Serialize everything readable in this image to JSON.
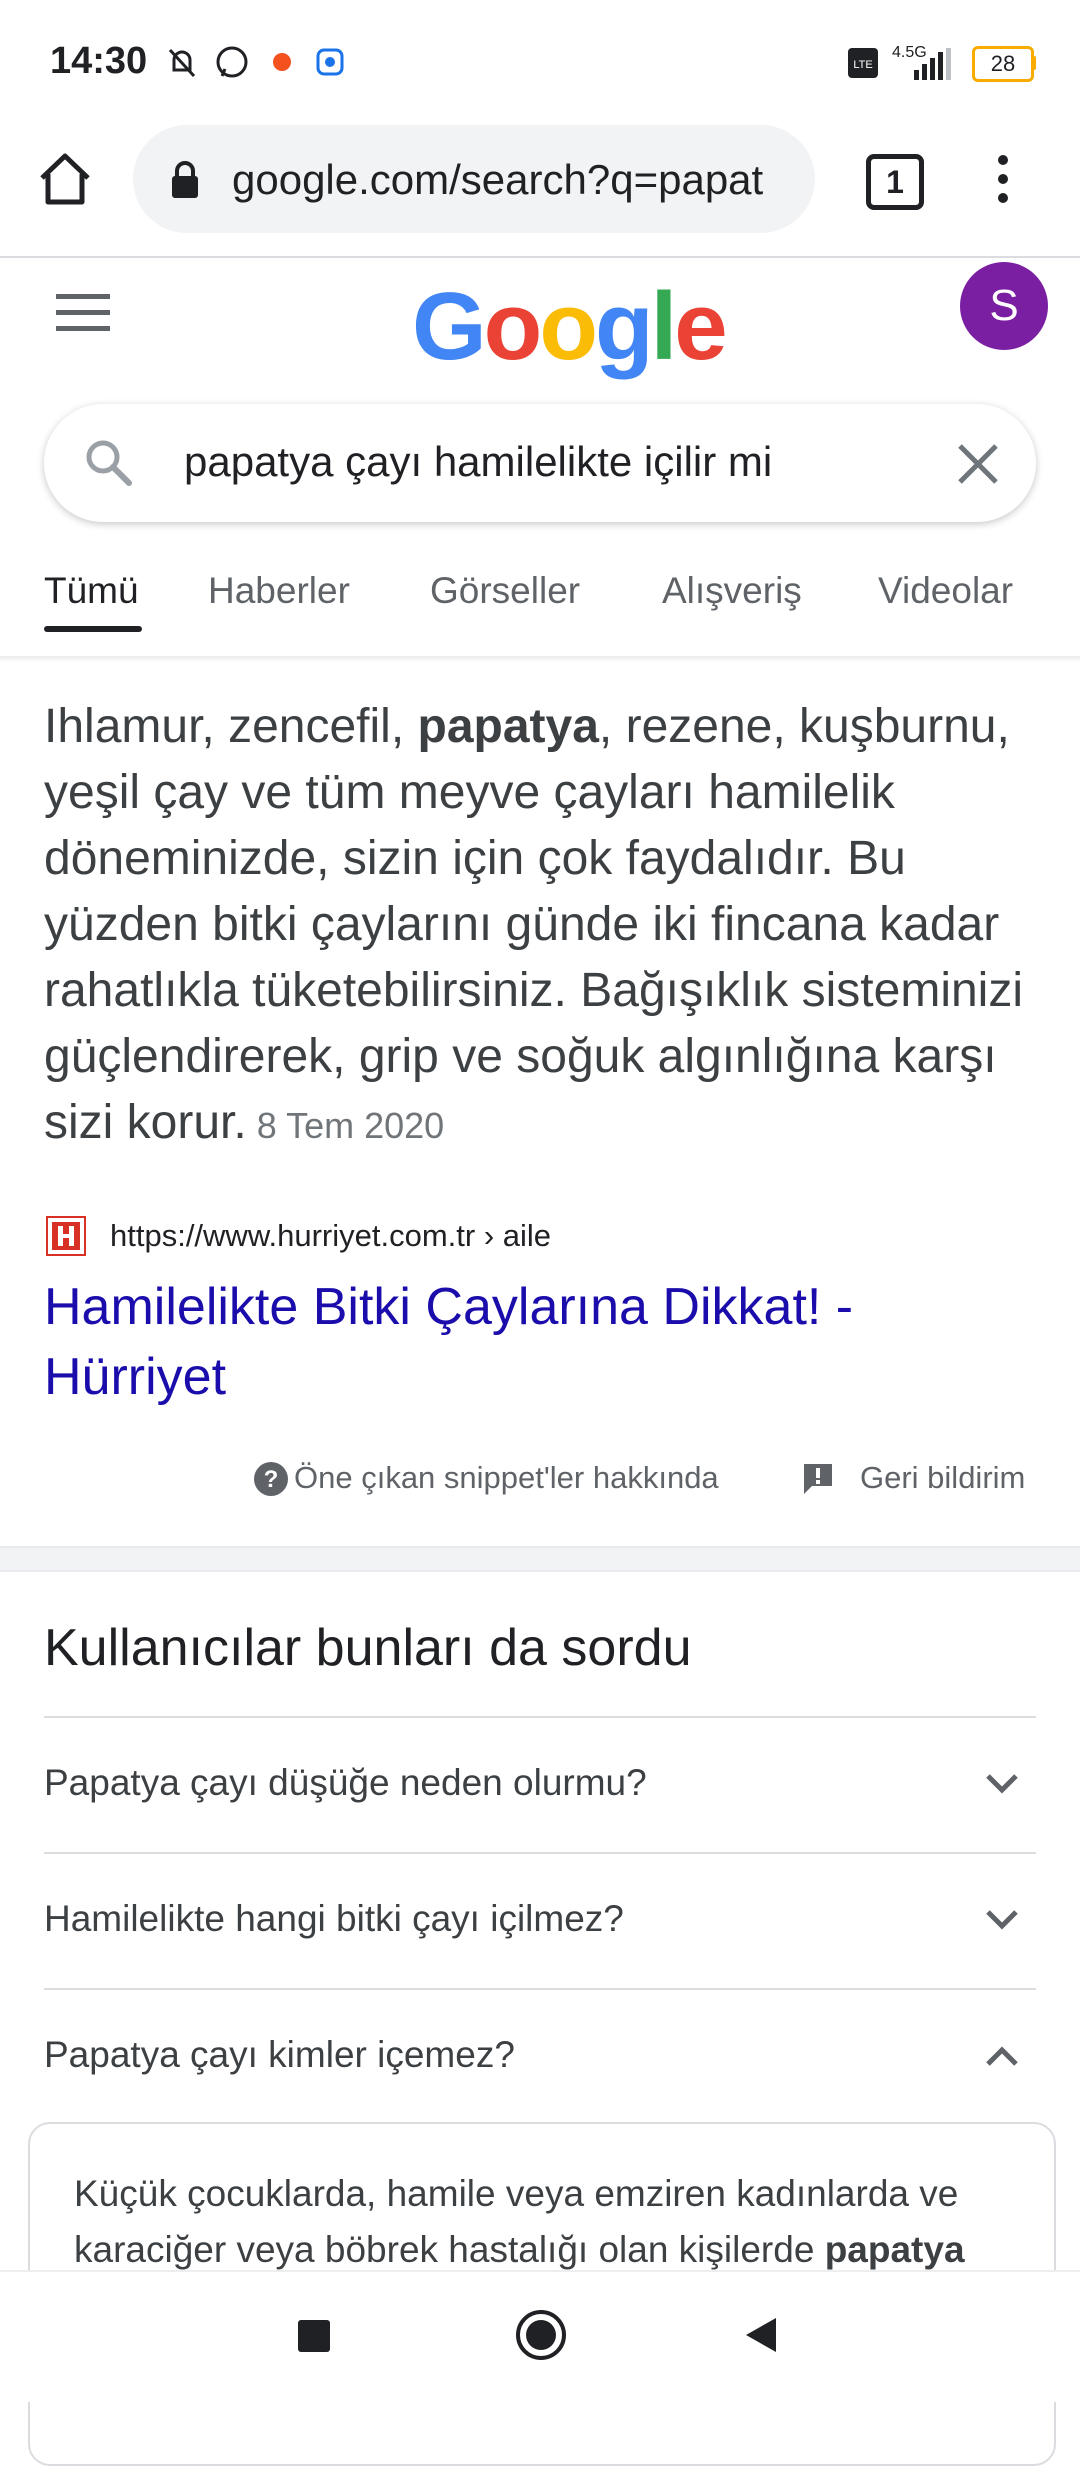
{
  "status_bar": {
    "time": "14:30",
    "network": "4.5G",
    "battery": "28",
    "icons": [
      "mute-icon",
      "whatsapp-icon",
      "notification-icon",
      "lens-icon",
      "volte-icon",
      "signal-icon",
      "battery-icon"
    ]
  },
  "browser": {
    "url": "google.com/search?q=papat",
    "tab_count": "1"
  },
  "google": {
    "avatar_letter": "S",
    "logo_letters": [
      "G",
      "o",
      "o",
      "g",
      "l",
      "e"
    ],
    "logo_colors": [
      "#4285F4",
      "#EA4335",
      "#FBBC05",
      "#4285F4",
      "#34A853",
      "#EA4335"
    ]
  },
  "search": {
    "query": "papatya çayı hamilelikte içilir mi"
  },
  "filter_tabs": [
    "Tümü",
    "Haberler",
    "Görseller",
    "Alışveriş",
    "Videolar"
  ],
  "snippet": {
    "text_before": "Ihlamur, zencefil, ",
    "text_bold": "papatya",
    "text_after": ", rezene, kuşburnu, yeşil çay ve tüm meyve çayları hamilelik döneminizde, sizin için çok faydalıdır. Bu yüzden bitki çaylarını günde iki fincana kadar rahatlıkla tüketebilirsiniz. Bağışıklık sisteminizi güçlendirerek, grip ve soğuk algınlığına karşı sizi korur.",
    "date": "8 Tem 2020",
    "site_url": "https://www.hurriyet.com.tr › aile",
    "result_title": "Hamilelikte Bitki Çaylarına Dikkat! - Hürriyet",
    "about_label": "Öne çıkan snippet'ler hakkında",
    "feedback_label": "Geri bildirim"
  },
  "people_also_ask": {
    "title": "Kullanıcılar bunları da sordu",
    "questions": [
      "Papatya çayı düşüğe neden olurmu?",
      "Hamilelikte hangi bitki çayı içilmez?",
      "Papatya çayı kimler içemez?"
    ],
    "answer_before": "Küçük çocuklarda, hamile veya emziren kadınlarda ve karaciğer veya böbrek hastalığı olan kişilerde ",
    "answer_bold": "papatya"
  },
  "colors": {
    "link": "#1a0dab",
    "avatar": "#7b1fa2"
  }
}
